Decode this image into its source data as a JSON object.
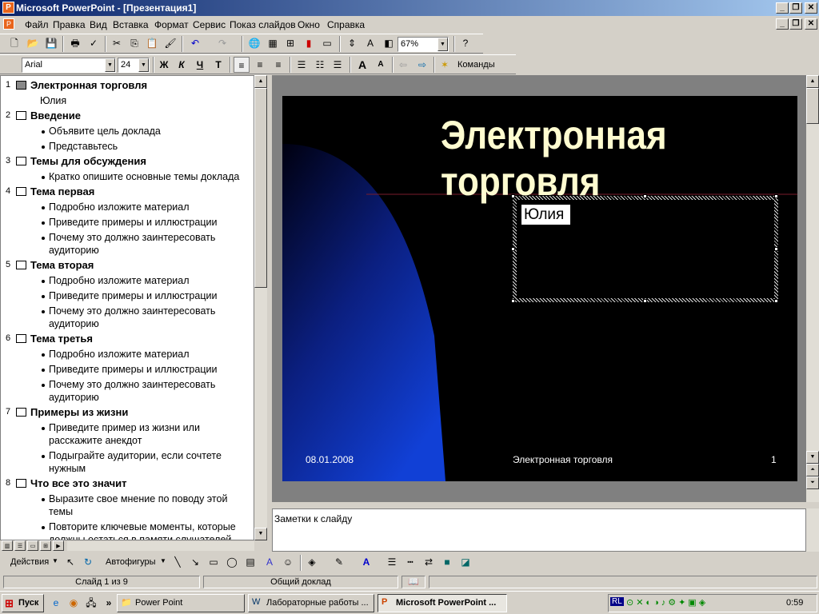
{
  "window": {
    "title": "Microsoft PowerPoint - [Презентация1]"
  },
  "menu": [
    "Файл",
    "Правка",
    "Вид",
    "Вставка",
    "Формат",
    "Сервис",
    "Показ слайдов",
    "Окно",
    "Справка"
  ],
  "toolbar": {
    "zoom": "67%"
  },
  "formatting": {
    "font": "Arial",
    "size": "24",
    "bold": "Ж",
    "italic": "К",
    "underline": "Ч",
    "shadow": "Т",
    "commands": "Команды"
  },
  "outline": [
    {
      "num": "1",
      "title": "Электронная торговля",
      "sub": [
        "Юлия"
      ],
      "plain": true
    },
    {
      "num": "2",
      "title": "Введение",
      "sub": [
        "Объявите цель доклада",
        "Представьтесь"
      ]
    },
    {
      "num": "3",
      "title": "Темы для обсуждения",
      "sub": [
        "Кратко опишите основные темы доклада"
      ]
    },
    {
      "num": "4",
      "title": "Тема первая",
      "sub": [
        "Подробно изложите материал",
        "Приведите примеры и иллюстрации",
        "Почему это должно заинтересовать|аудиторию"
      ]
    },
    {
      "num": "5",
      "title": "Тема вторая",
      "sub": [
        "Подробно изложите материал",
        "Приведите примеры и иллюстрации",
        "Почему это должно заинтересовать|аудиторию"
      ]
    },
    {
      "num": "6",
      "title": "Тема третья",
      "sub": [
        "Подробно изложите материал",
        "Приведите примеры и иллюстрации",
        "Почему это должно заинтересовать|аудиторию"
      ]
    },
    {
      "num": "7",
      "title": "Примеры из жизни",
      "sub": [
        "Приведите пример из жизни или|расскажите анекдот",
        "Подыграйте аудитории, если сочтете|нужным"
      ]
    },
    {
      "num": "8",
      "title": "Что все это значит",
      "sub": [
        "Выразите свое мнение по поводу этой|темы",
        "Повторите ключевые моменты, которые|должны остаться в памяти слушателей"
      ]
    }
  ],
  "slide": {
    "title_line1": "Электронная",
    "title_line2": "торговля",
    "subtitle": "Юлия",
    "date": "08.01.2008",
    "footer": "Электронная торговля",
    "number": "1"
  },
  "notes": {
    "placeholder": "Заметки к слайду"
  },
  "drawing": {
    "actions": "Действия",
    "autoshapes": "Автофигуры"
  },
  "status": {
    "slide": "Слайд 1 из 9",
    "design": "Общий доклад"
  },
  "taskbar": {
    "start": "Пуск",
    "items": [
      "Power Point",
      "Лабораторные работы ...",
      "Microsoft PowerPoint ..."
    ],
    "lang": "RL",
    "clock": "0:59"
  }
}
